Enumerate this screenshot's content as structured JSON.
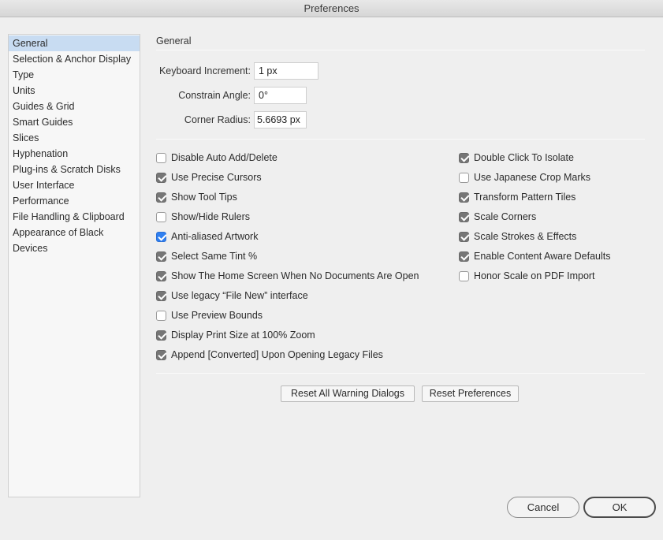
{
  "window": {
    "title": "Preferences"
  },
  "sidebar": {
    "items": [
      {
        "label": "General",
        "selected": true
      },
      {
        "label": "Selection & Anchor Display"
      },
      {
        "label": "Type"
      },
      {
        "label": "Units"
      },
      {
        "label": "Guides & Grid"
      },
      {
        "label": "Smart Guides"
      },
      {
        "label": "Slices"
      },
      {
        "label": "Hyphenation"
      },
      {
        "label": "Plug-ins & Scratch Disks"
      },
      {
        "label": "User Interface"
      },
      {
        "label": "Performance"
      },
      {
        "label": "File Handling & Clipboard"
      },
      {
        "label": "Appearance of Black"
      },
      {
        "label": "Devices"
      }
    ]
  },
  "general": {
    "section_title": "General",
    "fields": {
      "keyboard_increment": {
        "label": "Keyboard Increment:",
        "value": "1 px"
      },
      "constrain_angle": {
        "label": "Constrain Angle:",
        "value": "0°"
      },
      "corner_radius": {
        "label": "Corner Radius:",
        "value": "5.6693 px"
      }
    },
    "left_options": [
      {
        "label": "Disable Auto Add/Delete",
        "checked": false
      },
      {
        "label": "Use Precise Cursors",
        "checked": true
      },
      {
        "label": "Show Tool Tips",
        "checked": true
      },
      {
        "label": "Show/Hide Rulers",
        "checked": false
      },
      {
        "label": "Anti-aliased Artwork",
        "checked": true
      },
      {
        "label": "Select Same Tint %",
        "checked": true
      },
      {
        "label": "Show The Home Screen When No Documents Are Open",
        "checked": true
      },
      {
        "label": "Use legacy “File New” interface",
        "checked": true
      },
      {
        "label": "Use Preview Bounds",
        "checked": false
      },
      {
        "label": "Display Print Size at 100% Zoom",
        "checked": true
      },
      {
        "label": "Append [Converted] Upon Opening Legacy Files",
        "checked": true
      }
    ],
    "right_options": [
      {
        "label": "Double Click To Isolate",
        "checked": true
      },
      {
        "label": "Use Japanese Crop Marks",
        "checked": false
      },
      {
        "label": "Transform Pattern Tiles",
        "checked": true
      },
      {
        "label": "Scale Corners",
        "checked": true
      },
      {
        "label": "Scale Strokes & Effects",
        "checked": true
      },
      {
        "label": "Enable Content Aware Defaults",
        "checked": true
      },
      {
        "label": "Honor Scale on PDF Import",
        "checked": false
      }
    ],
    "buttons": {
      "reset_warnings": "Reset All Warning Dialogs",
      "reset_preferences": "Reset Preferences"
    }
  },
  "footer": {
    "cancel": "Cancel",
    "ok": "OK"
  },
  "colors": {
    "selection": "#c8dcf2",
    "accent_checkbox": "#2f7ff0",
    "checkbox": "#767676"
  }
}
